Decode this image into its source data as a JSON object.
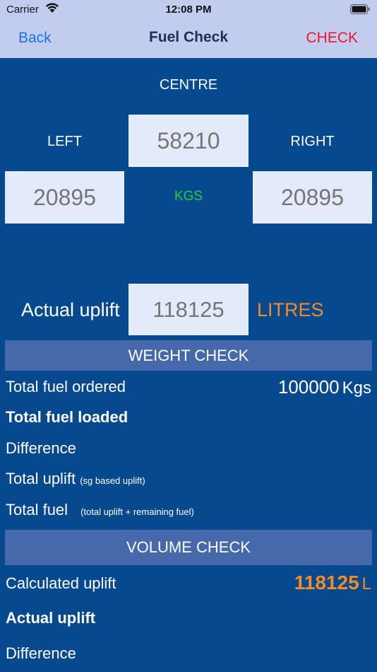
{
  "status": {
    "carrier": "Carrier",
    "time": "12:08 PM"
  },
  "nav": {
    "back": "Back",
    "title": "Fuel Check",
    "check": "CHECK"
  },
  "tanks": {
    "centre_label": "CENTRE",
    "left_label": "LEFT",
    "right_label": "RIGHT",
    "centre_value": "58210",
    "left_value": "20895",
    "right_value": "20895",
    "unit": "KGS"
  },
  "uplift": {
    "label": "Actual uplift",
    "value": "118125",
    "unit": "LITRES"
  },
  "weight_check": {
    "header": "WEIGHT CHECK",
    "total_fuel_ordered_label": "Total fuel ordered",
    "total_fuel_ordered_value": "100000",
    "total_fuel_ordered_unit": "Kgs",
    "total_fuel_loaded_label": "Total fuel loaded",
    "difference_label": "Difference",
    "total_uplift_label": "Total uplift",
    "total_uplift_note": "(sg based uplift)",
    "total_fuel_label": "Total fuel",
    "total_fuel_note": "(total uplift + remaining fuel)"
  },
  "volume_check": {
    "header": "VOLUME CHECK",
    "calculated_uplift_label": "Calculated uplift",
    "calculated_uplift_value": "118125",
    "calculated_uplift_unit": "L",
    "actual_uplift_label": "Actual uplift",
    "difference_label": "Difference"
  },
  "colors": {
    "background": "#06498f",
    "nav_bar": "#c2ccef",
    "accent_red": "#e8192c",
    "accent_orange": "#f58b23",
    "kgs_green": "#18d23e",
    "section_header": "#4569ab"
  }
}
